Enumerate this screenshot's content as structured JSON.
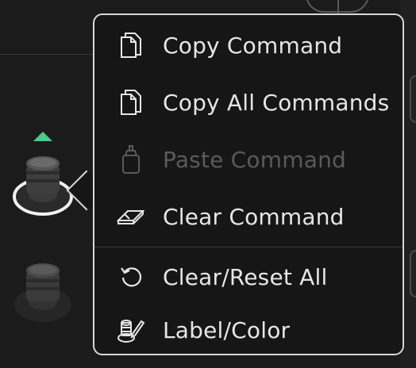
{
  "menu": {
    "items": [
      {
        "label": "Copy Command",
        "icon": "copy-icon",
        "enabled": true
      },
      {
        "label": "Copy All Commands",
        "icon": "copy-icon",
        "enabled": true
      },
      {
        "label": "Paste Command",
        "icon": "paste-bottle-icon",
        "enabled": false
      },
      {
        "label": "Clear Command",
        "icon": "eraser-icon",
        "enabled": true
      },
      {
        "label": "Clear/Reset All",
        "icon": "reset-icon",
        "enabled": true
      },
      {
        "label": "Label/Color",
        "icon": "label-color-icon",
        "enabled": true
      }
    ]
  },
  "colors": {
    "indicator": "#4fc98a",
    "menu_border": "#d8d8d8",
    "menu_text": "#e6e6e6",
    "disabled_text": "#5a5a5a"
  }
}
